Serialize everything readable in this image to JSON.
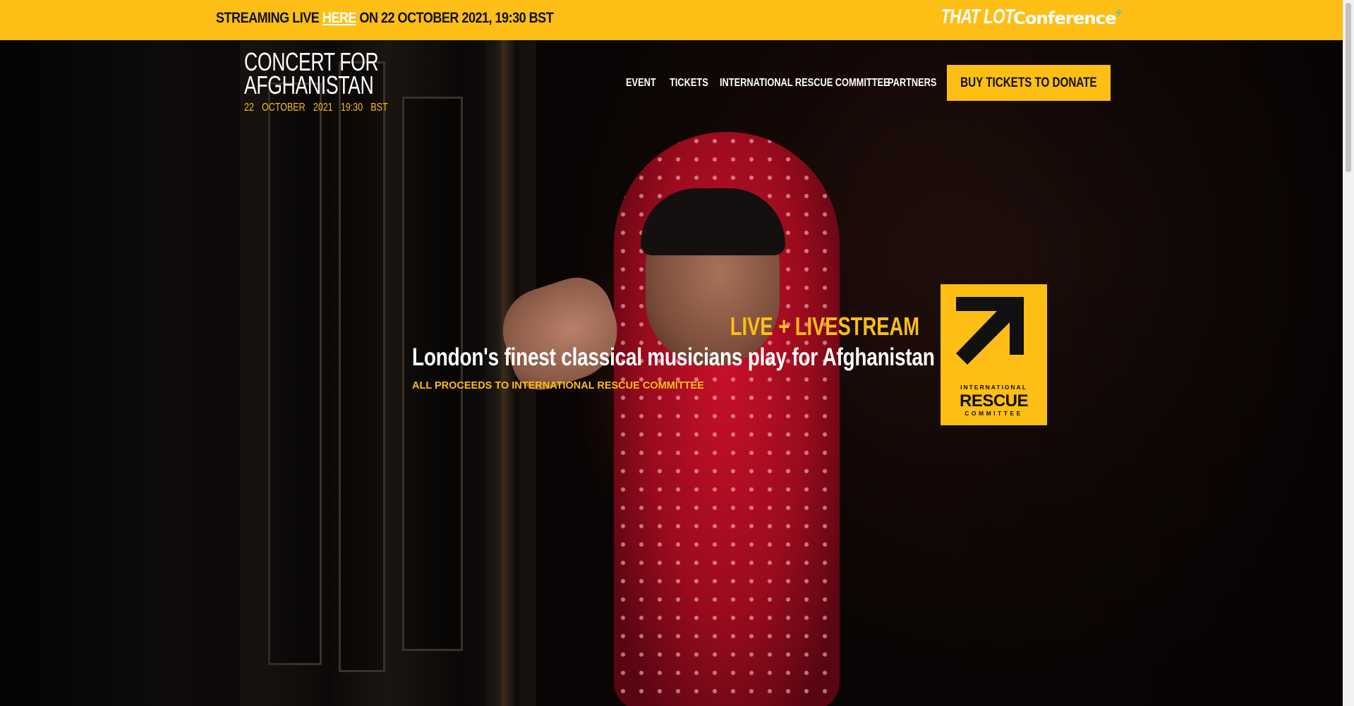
{
  "banner": {
    "prefix": "STREAMING LIVE ",
    "link": "HERE",
    "suffix": " ON 22 OCTOBER 2021, 19:30 BST",
    "partner_1": "THAT LOT",
    "partner_2": "Conference",
    "partner_2_mark": "+",
    "background": "#fdbe16"
  },
  "logo": {
    "line1": "CONCERT FOR",
    "line2": "AFGHANISTAN",
    "date": "22 OCTOBER 2021   19:30 BST"
  },
  "nav": {
    "items": [
      "EVENT",
      "TICKETS",
      "INTERNATIONAL RESCUE COMMITTEE",
      "PARTNERS"
    ],
    "cta": "BUY TICKETS TO DONATE"
  },
  "hero": {
    "kicker": "LIVE + LIVESTREAM",
    "headline": "London's finest classical musicians play for Afghanistan",
    "subline": "ALL PROCEEDS TO INTERNATIONAL RESCUE COMMITTEE",
    "accent": "#fdbe16"
  },
  "irc_logo": {
    "line1": "INTERNATIONAL",
    "line2": "RESCUE",
    "line3": "COMMITTEE"
  }
}
